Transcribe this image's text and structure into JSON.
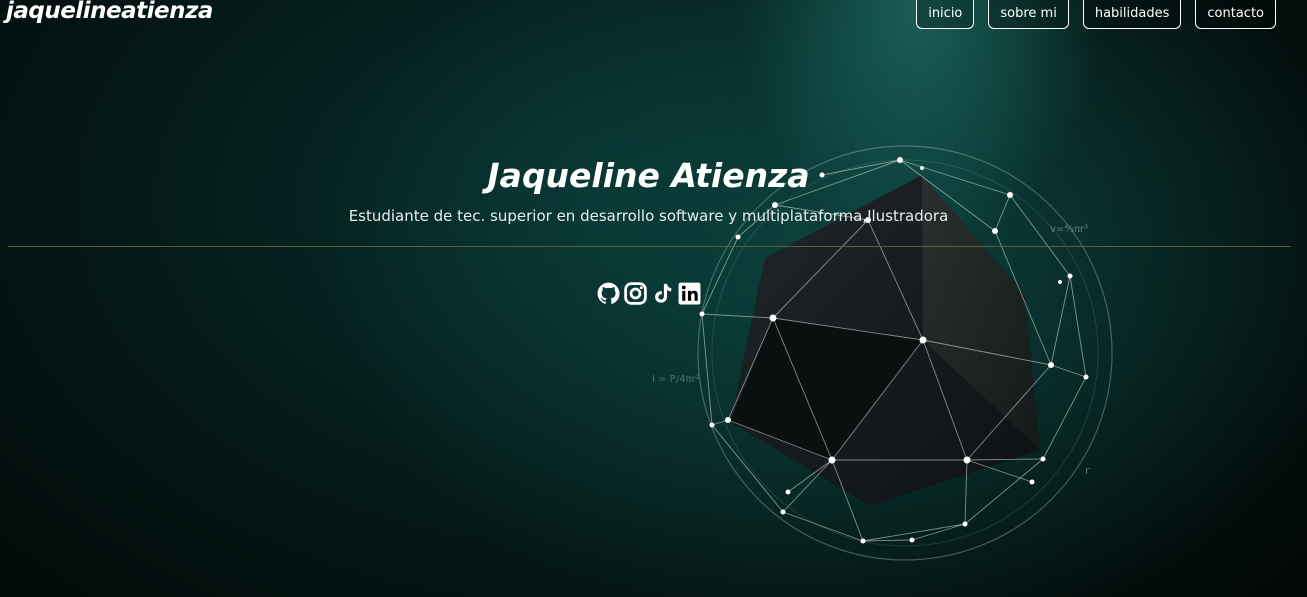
{
  "header": {
    "brand": "jaquelineatienza",
    "nav": [
      {
        "label": "inicio"
      },
      {
        "label": "sobre mi"
      },
      {
        "label": "habilidades"
      },
      {
        "label": "contacto"
      }
    ]
  },
  "hero": {
    "title": "Jaqueline Atienza",
    "subtitle": "Estudiante de tec. superior en desarrollo software y multiplataforma,Ilustradora",
    "socials": [
      {
        "icon": "github-icon"
      },
      {
        "icon": "instagram-icon"
      },
      {
        "icon": "tiktok-icon"
      },
      {
        "icon": "linkedin-icon"
      }
    ]
  },
  "background": {
    "formula_volume": "v=⁴⁄₃πr³",
    "formula_intensity": "I = P/4πr²",
    "radius_label": "r"
  },
  "colors": {
    "accent_line": "#5a6038",
    "bg_teal": "#06302e"
  }
}
